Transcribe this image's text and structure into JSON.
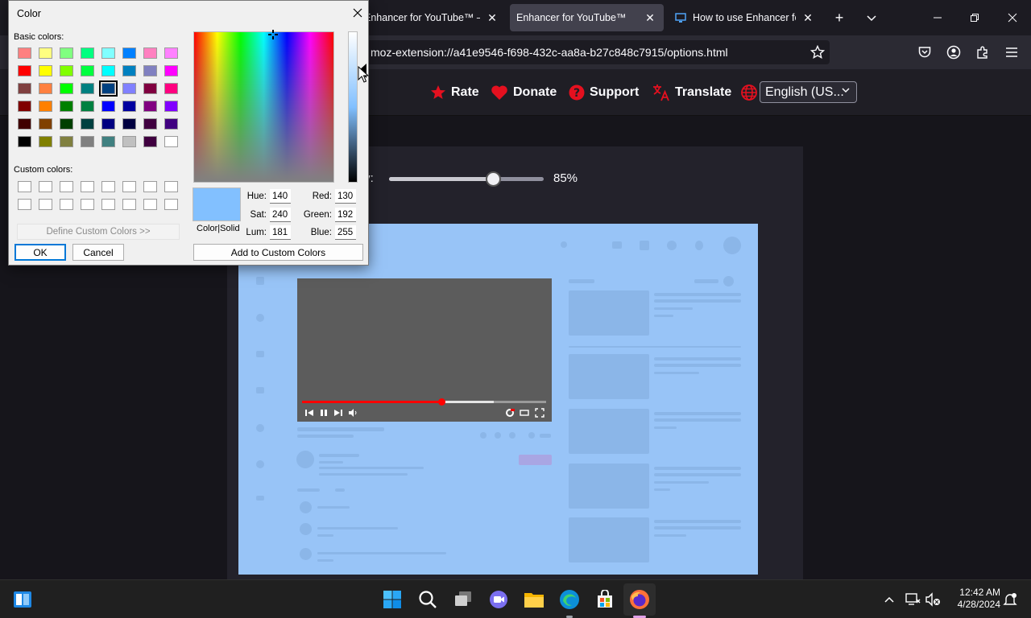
{
  "tabs": [
    {
      "label": "Enhancer for YouTube™ –",
      "close": "✕"
    },
    {
      "label": "Enhancer for YouTube™",
      "close": "✕"
    },
    {
      "label": "How to use Enhancer for",
      "close": "✕"
    }
  ],
  "tabbar_icons": {
    "new_tab": "plus-icon",
    "list_tabs": "chevron-down-icon"
  },
  "url": "moz-extension://a41e9546-f698-432c-aa8a-b27c848c7915/options.html",
  "header": {
    "rate": "Rate",
    "donate": "Donate",
    "support": "Support",
    "translate": "Translate",
    "language": "English (US..."
  },
  "settings": {
    "opacity_label": "ty:",
    "opacity_value": "85%",
    "opacity_fraction": 0.85
  },
  "dialog": {
    "title": "Color",
    "basic_colors_label": "Basic colors:",
    "custom_colors_label": "Custom colors:",
    "define_custom": "Define Custom Colors >>",
    "ok": "OK",
    "cancel": "Cancel",
    "add_custom": "Add to Custom Colors",
    "color_solid": "Color|Solid",
    "hue_label": "Hue:",
    "hue": "140",
    "sat_label": "Sat:",
    "sat": "240",
    "lum_label": "Lum:",
    "lum": "181",
    "red_label": "Red:",
    "red": "130",
    "green_label": "Green:",
    "green": "192",
    "blue_label": "Blue:",
    "blue": "255",
    "selected_color": "#82c0ff",
    "basic_colors": [
      [
        "#ff8080",
        "#ffff80",
        "#80ff80",
        "#00ff80",
        "#80ffff",
        "#0080ff",
        "#ff80c0",
        "#ff80ff"
      ],
      [
        "#ff0000",
        "#ffff00",
        "#80ff00",
        "#00ff40",
        "#00ffff",
        "#0080c0",
        "#8080c0",
        "#ff00ff"
      ],
      [
        "#804040",
        "#ff8040",
        "#00ff00",
        "#008080",
        "#004080",
        "#8080ff",
        "#800040",
        "#ff0080"
      ],
      [
        "#800000",
        "#ff8000",
        "#008000",
        "#008040",
        "#0000ff",
        "#0000a0",
        "#800080",
        "#8000ff"
      ],
      [
        "#400000",
        "#804000",
        "#004000",
        "#004040",
        "#000080",
        "#000040",
        "#400040",
        "#400080"
      ],
      [
        "#000000",
        "#808000",
        "#808040",
        "#808080",
        "#408080",
        "#c0c0c0",
        "#400040",
        "#ffffff"
      ]
    ],
    "selected_swatch": [
      2,
      4
    ]
  },
  "taskbar": {
    "time": "12:42 AM",
    "date": "4/28/2024"
  }
}
